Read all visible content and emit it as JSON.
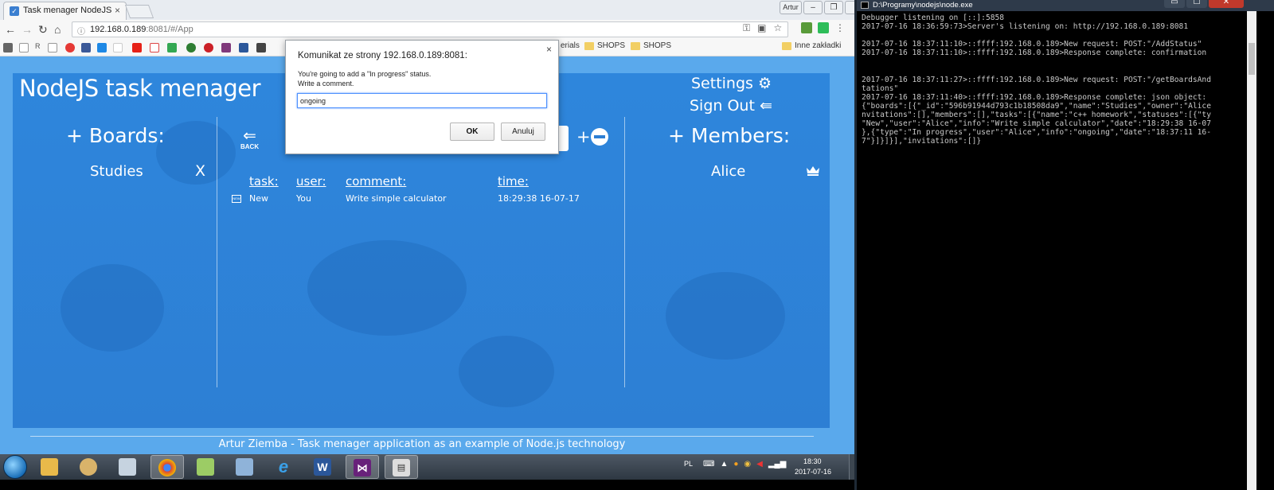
{
  "browser": {
    "tab_title": "Task menager NodeJS",
    "tab_icon": "task-favicon",
    "user_button": "Artur",
    "address": {
      "host": "192.168.0.189",
      "path": ":8081/#/App"
    },
    "bookmarks": {
      "folders": [
        "erials",
        "SHOPS",
        "SHOPS"
      ],
      "other": "Inne zakładki",
      "prefix_label": "R"
    }
  },
  "app": {
    "title": "NodeJS task menager",
    "settings_label": "Settings ⚙",
    "signout_label": "Sign Out ⇚",
    "boards_heading": "+ Boards:",
    "boards": [
      {
        "name": "Studies",
        "delete_label": "X"
      }
    ],
    "members_heading": "+ Members:",
    "members": [
      {
        "name": "Alice",
        "role_icon": "crown-icon"
      }
    ],
    "back_label": "BACK",
    "add_remove_label": "+",
    "table": {
      "headers": {
        "task": "task:",
        "user": "user:",
        "comment": "comment:",
        "time": "time:"
      },
      "rows": [
        {
          "icon": "new-icon",
          "icon_text": "NEW",
          "task": "New",
          "user": "You",
          "comment": "Write simple calculator",
          "time": "18:29:38 16-07-17"
        }
      ]
    },
    "footer": "Artur Ziemba - Task menager application as an example of Node.js technology"
  },
  "dialog": {
    "title": "Komunikat ze strony 192.168.0.189:8081:",
    "message_line1": "You're going to add a \"In progress\" status.",
    "message_line2": "Write a comment.",
    "input_value": "ongoing",
    "ok_label": "OK",
    "cancel_label": "Anuluj",
    "close_label": "×"
  },
  "taskbar": {
    "apps": [
      "explorer",
      "paint",
      "calculator",
      "chrome",
      "notepad-plus",
      "files",
      "internet-explorer",
      "word",
      "visual-studio",
      "node-console"
    ],
    "language": "PL",
    "time": "18:30",
    "date": "2017-07-16"
  },
  "console": {
    "title": "D:\\Programy\\nodejs\\node.exe",
    "output": "Debugger listening on [::]:5858\n2017-07-16 18:36:59:73>Server's listening on: http://192.168.0.189:8081\n\n2017-07-16 18:37:11:10>::ffff:192.168.0.189>New request: POST:\"/AddStatus\"\n2017-07-16 18:37:11:10>::ffff:192.168.0.189>Response complete: confirmation\n\n\n2017-07-16 18:37:11:27>::ffff:192.168.0.189>New request: POST:\"/getBoardsAnd\ntations\"\n2017-07-16 18:37:11:40>::ffff:192.168.0.189>Response complete: json object:\n{\"boards\":[{\"_id\":\"596b91944d793c1b18508da9\",\"name\":\"Studies\",\"owner\":\"Alice\nnvitations\":[],\"members\":[],\"tasks\":[{\"name\":\"c++ homework\",\"statuses\":[{\"ty\n\"New\",\"user\":\"Alice\",\"info\":\"Write simple calculator\",\"date\":\"18:29:38 16-07\n},{\"type\":\"In progress\",\"user\":\"Alice\",\"info\":\"ongoing\",\"date\":\"18:37:11 16-\n7\"}]}]}],\"invitations\":[]}"
  }
}
